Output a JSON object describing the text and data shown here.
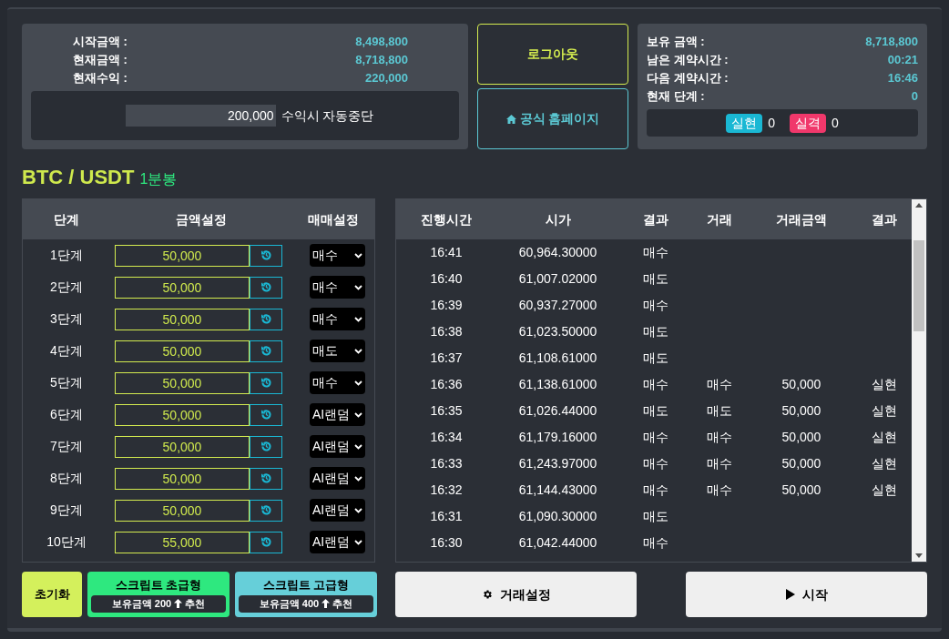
{
  "summary": {
    "rows": [
      {
        "label": "시작금액 :",
        "value": "8,498,800"
      },
      {
        "label": "현재금액 :",
        "value": "8,718,800"
      },
      {
        "label": "현재수익 :",
        "value": "220,000"
      }
    ],
    "auto_stop": {
      "value": "200,000",
      "label": "수익시 자동중단"
    }
  },
  "logout_button": "로그아웃",
  "homepage_button": "공식 홈페이지",
  "status": {
    "rows": [
      {
        "label": "보유 금액 :",
        "value": "8,718,800"
      },
      {
        "label": "남은 계약시간 :",
        "value": "00:21"
      },
      {
        "label": "다음 계약시간 :",
        "value": "16:46"
      },
      {
        "label": "현재 단계 :",
        "value": "0"
      }
    ],
    "badges": [
      {
        "label": "실현",
        "count": "0",
        "color": "#1ab8d4"
      },
      {
        "label": "실격",
        "count": "0",
        "color": "#f0386b"
      }
    ]
  },
  "pair": {
    "symbol": "BTC / USDT",
    "interval": "1분봉"
  },
  "steps": {
    "columns": [
      "단계",
      "금액설정",
      "매매설정"
    ],
    "rows": [
      {
        "step": "1단계",
        "amount": "50,000",
        "mode": "매수"
      },
      {
        "step": "2단계",
        "amount": "50,000",
        "mode": "매수"
      },
      {
        "step": "3단계",
        "amount": "50,000",
        "mode": "매수"
      },
      {
        "step": "4단계",
        "amount": "50,000",
        "mode": "매도"
      },
      {
        "step": "5단계",
        "amount": "50,000",
        "mode": "매수"
      },
      {
        "step": "6단계",
        "amount": "50,000",
        "mode": "AI랜덤"
      },
      {
        "step": "7단계",
        "amount": "50,000",
        "mode": "AI랜덤"
      },
      {
        "step": "8단계",
        "amount": "50,000",
        "mode": "AI랜덤"
      },
      {
        "step": "9단계",
        "amount": "50,000",
        "mode": "AI랜덤"
      },
      {
        "step": "10단계",
        "amount": "55,000",
        "mode": "AI랜덤"
      }
    ]
  },
  "history": {
    "columns": [
      "진행시간",
      "시가",
      "결과",
      "거래",
      "거래금액",
      "결과"
    ],
    "rows": [
      {
        "time": "16:41",
        "price": "60,964.30000",
        "result": "매수"
      },
      {
        "time": "16:40",
        "price": "61,007.02000",
        "result": "매도"
      },
      {
        "time": "16:39",
        "price": "60,937.27000",
        "result": "매수"
      },
      {
        "time": "16:38",
        "price": "61,023.50000",
        "result": "매도"
      },
      {
        "time": "16:37",
        "price": "61,108.61000",
        "result": "매도"
      },
      {
        "time": "16:36",
        "price": "61,138.61000",
        "result": "매수",
        "trade": "매수",
        "amount": "50,000",
        "outcome": "실현"
      },
      {
        "time": "16:35",
        "price": "61,026.44000",
        "result": "매도",
        "trade": "매도",
        "amount": "50,000",
        "outcome": "실현"
      },
      {
        "time": "16:34",
        "price": "61,179.16000",
        "result": "매수",
        "trade": "매수",
        "amount": "50,000",
        "outcome": "실현"
      },
      {
        "time": "16:33",
        "price": "61,243.97000",
        "result": "매수",
        "trade": "매수",
        "amount": "50,000",
        "outcome": "실현"
      },
      {
        "time": "16:32",
        "price": "61,144.43000",
        "result": "매수",
        "trade": "매수",
        "amount": "50,000",
        "outcome": "실현"
      },
      {
        "time": "16:31",
        "price": "61,090.30000",
        "result": "매도"
      },
      {
        "time": "16:30",
        "price": "61,042.44000",
        "result": "매수"
      }
    ]
  },
  "reset_button": "초기화",
  "scripts": [
    {
      "title": "스크립트 초급형",
      "note": "보유금액 200",
      "suffix": "추천",
      "color": "#2ee87f"
    },
    {
      "title": "스크립트 고급형",
      "note": "보유금액 400",
      "suffix": "추천",
      "color": "#66cfd9"
    }
  ],
  "settings_button": "거래설정",
  "start_button": "시작"
}
